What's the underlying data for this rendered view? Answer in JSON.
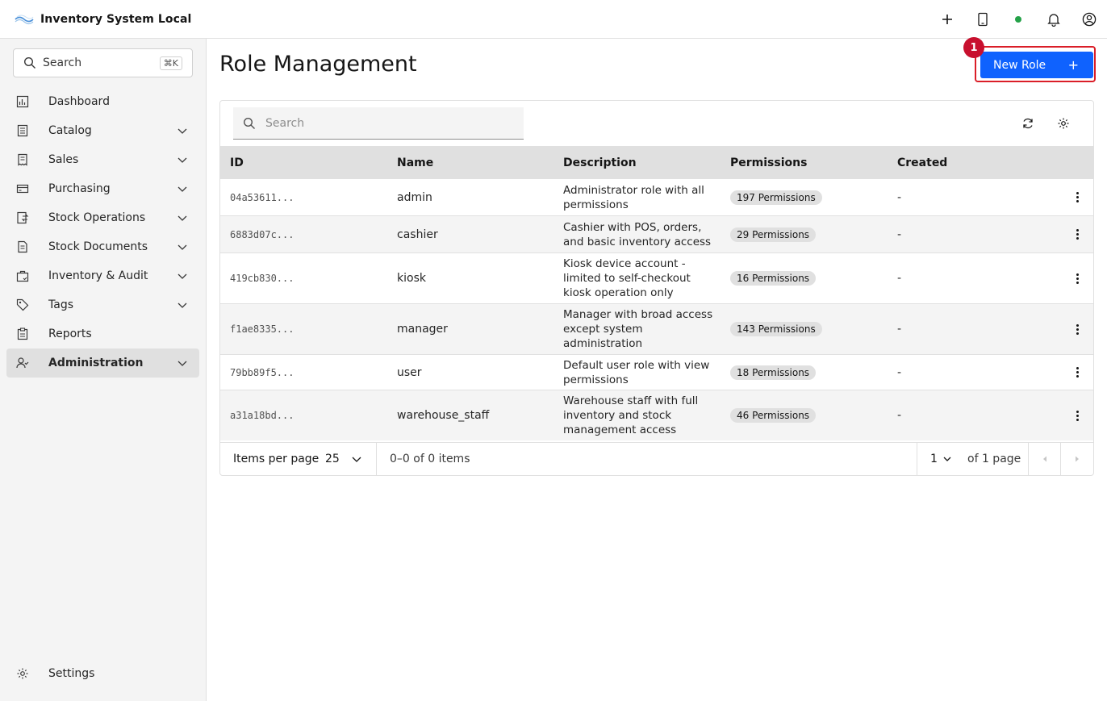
{
  "app": {
    "title": "Inventory System Local"
  },
  "header": {
    "icons": [
      "add-icon",
      "tablet-icon",
      "status-dot-icon",
      "notification-icon",
      "user-avatar-icon"
    ],
    "status_color": "#24a148"
  },
  "sidebar": {
    "search_label": "Search",
    "search_shortcut": "⌘K",
    "items": [
      {
        "label": "Dashboard",
        "icon": "dashboard-icon",
        "expandable": false
      },
      {
        "label": "Catalog",
        "icon": "catalog-icon",
        "expandable": true
      },
      {
        "label": "Sales",
        "icon": "sales-icon",
        "expandable": true
      },
      {
        "label": "Purchasing",
        "icon": "purchasing-icon",
        "expandable": true
      },
      {
        "label": "Stock Operations",
        "icon": "stock-operations-icon",
        "expandable": true
      },
      {
        "label": "Stock Documents",
        "icon": "stock-documents-icon",
        "expandable": true
      },
      {
        "label": "Inventory & Audit",
        "icon": "inventory-audit-icon",
        "expandable": true
      },
      {
        "label": "Tags",
        "icon": "tag-icon",
        "expandable": true
      },
      {
        "label": "Reports",
        "icon": "reports-icon",
        "expandable": false
      },
      {
        "label": "Administration",
        "icon": "administration-icon",
        "expandable": true,
        "active": true
      }
    ],
    "settings_label": "Settings"
  },
  "main": {
    "title": "Role Management",
    "new_role_label": "New Role",
    "marker_label": "1",
    "accent_color": "#0f62fe",
    "highlight_color": "#da1e28"
  },
  "table": {
    "search_placeholder": "Search",
    "columns": {
      "id": "ID",
      "name": "Name",
      "description": "Description",
      "permissions": "Permissions",
      "created": "Created"
    },
    "rows": [
      {
        "id": "04a53611...",
        "name": "admin",
        "description": "Administrator role with all permissions",
        "permissions": "197 Permissions",
        "created": "-"
      },
      {
        "id": "6883d07c...",
        "name": "cashier",
        "description": "Cashier with POS, orders, and basic inventory access",
        "permissions": "29 Permissions",
        "created": "-"
      },
      {
        "id": "419cb830...",
        "name": "kiosk",
        "description": "Kiosk device account - limited to self-checkout kiosk operation only",
        "permissions": "16 Permissions",
        "created": "-"
      },
      {
        "id": "f1ae8335...",
        "name": "manager",
        "description": "Manager with broad access except system administration",
        "permissions": "143 Permissions",
        "created": "-"
      },
      {
        "id": "79bb89f5...",
        "name": "user",
        "description": "Default user role with view permissions",
        "permissions": "18 Permissions",
        "created": "-"
      },
      {
        "id": "a31a18bd...",
        "name": "warehouse_staff",
        "description": "Warehouse staff with full inventory and stock management access",
        "permissions": "46 Permissions",
        "created": "-"
      }
    ]
  },
  "pagination": {
    "items_per_page_label": "Items per page",
    "items_per_page_value": "25",
    "range_text": "0–0 of 0 items",
    "page_value": "1",
    "page_of_text": "of 1 page"
  }
}
